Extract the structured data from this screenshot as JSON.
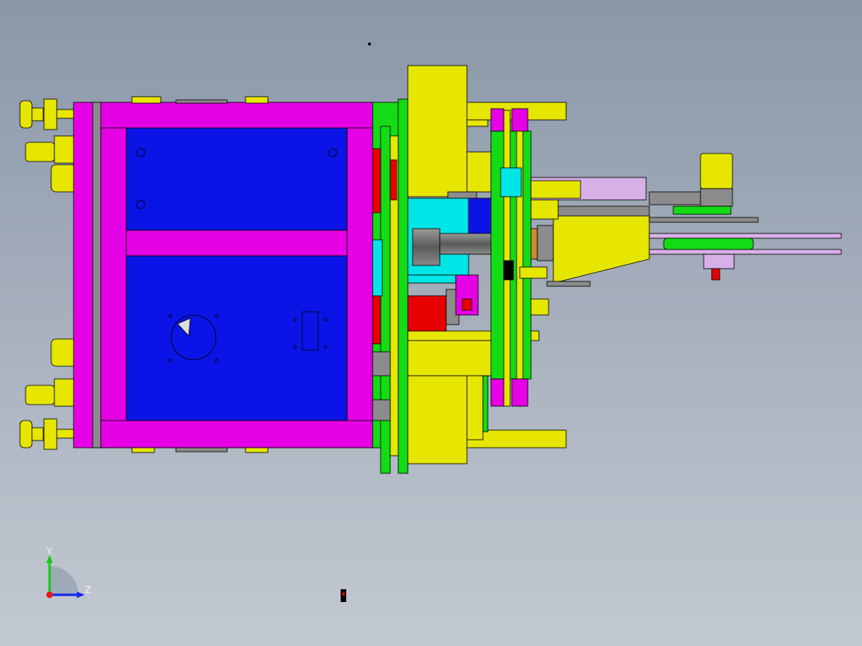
{
  "view": {
    "background_top": "#8a97a8",
    "background_bottom": "#c3c9d2",
    "edge_color": "#000000"
  },
  "part_colors": {
    "frame": "#e600e6",
    "panel": "#0a14e6",
    "plate_yellow": "#e6e600",
    "plate_green": "#14dc14",
    "cyan": "#00e6e6",
    "red": "#e60000",
    "shaft": "#6e6e6e",
    "lavender": "#d8b0e8",
    "grey": "#8c8c8c",
    "bronze": "#c88c32"
  },
  "triad": {
    "y_label": "Y",
    "z_label": "Z",
    "y_color": "#14c814",
    "z_color": "#1428e6",
    "origin_color": "#e61414"
  }
}
